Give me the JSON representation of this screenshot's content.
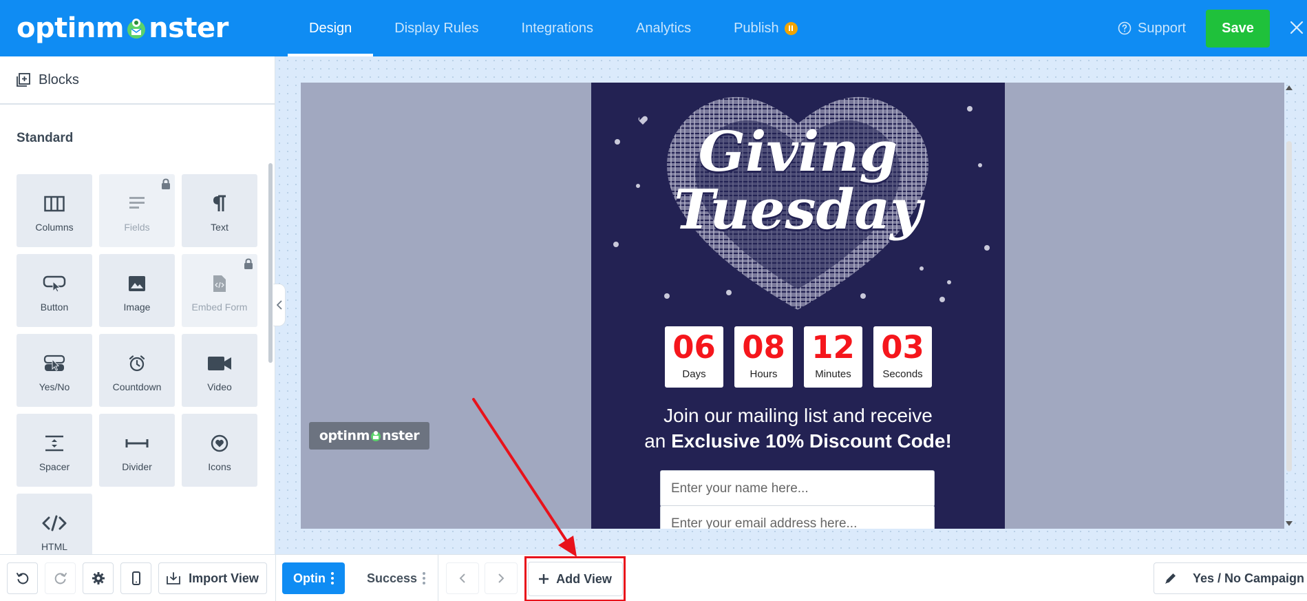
{
  "app": {
    "logo_text_pre": "optinm",
    "logo_text_post": "nster"
  },
  "nav": {
    "tabs": [
      {
        "label": "Design",
        "active": true
      },
      {
        "label": "Display Rules",
        "active": false
      },
      {
        "label": "Integrations",
        "active": false
      },
      {
        "label": "Analytics",
        "active": false
      },
      {
        "label": "Publish",
        "active": false,
        "status_icon": "pause-badge-icon"
      }
    ],
    "support_label": "Support",
    "save_label": "Save",
    "close_icon": "close-icon"
  },
  "sidebar": {
    "header": "Blocks",
    "section_title": "Standard",
    "blocks": [
      {
        "label": "Columns",
        "icon": "columns-icon",
        "locked": false
      },
      {
        "label": "Fields",
        "icon": "fields-icon",
        "locked": true
      },
      {
        "label": "Text",
        "icon": "paragraph-icon",
        "locked": false
      },
      {
        "label": "Button",
        "icon": "button-cursor-icon",
        "locked": false
      },
      {
        "label": "Image",
        "icon": "image-icon",
        "locked": false
      },
      {
        "label": "Embed Form",
        "icon": "embed-code-icon",
        "locked": true
      },
      {
        "label": "Yes/No",
        "icon": "yes-no-icon",
        "locked": false
      },
      {
        "label": "Countdown",
        "icon": "alarm-clock-icon",
        "locked": false
      },
      {
        "label": "Video",
        "icon": "video-camera-icon",
        "locked": false
      },
      {
        "label": "Spacer",
        "icon": "spacer-icon",
        "locked": false
      },
      {
        "label": "Divider",
        "icon": "divider-icon",
        "locked": false
      },
      {
        "label": "Icons",
        "icon": "heart-circle-icon",
        "locked": false
      },
      {
        "label": "HTML",
        "icon": "code-icon",
        "locked": false
      }
    ]
  },
  "campaign": {
    "headline_line1": "Giving",
    "headline_line2": "Tuesday",
    "countdown": [
      {
        "value": "06",
        "label": "Days"
      },
      {
        "value": "08",
        "label": "Hours"
      },
      {
        "value": "12",
        "label": "Minutes"
      },
      {
        "value": "03",
        "label": "Seconds"
      }
    ],
    "promo_line1": "Join our mailing list and receive",
    "promo_line2_prefix": "an ",
    "promo_line2_bold": "Exclusive 10% Discount Code!",
    "name_placeholder": "Enter your name here...",
    "email_placeholder": "Enter your email address here...",
    "badge_text_pre": "optinm",
    "badge_text_post": "nster"
  },
  "bottombar": {
    "undo_icon": "undo-icon",
    "redo_icon": "redo-icon",
    "settings_icon": "gear-icon",
    "mobile_icon": "mobile-icon",
    "import_view_label": "Import View",
    "views": [
      {
        "label": "Optin",
        "active": true
      },
      {
        "label": "Success",
        "active": false
      }
    ],
    "add_view_label": "Add View",
    "campaign_type_label": "Yes / No Campaign"
  },
  "colors": {
    "brand_blue": "#0f8cf3",
    "save_green": "#1fc13b",
    "campaign_bg": "#232253",
    "countdown_red": "#f5161c",
    "annotation_red": "#e8121b"
  }
}
